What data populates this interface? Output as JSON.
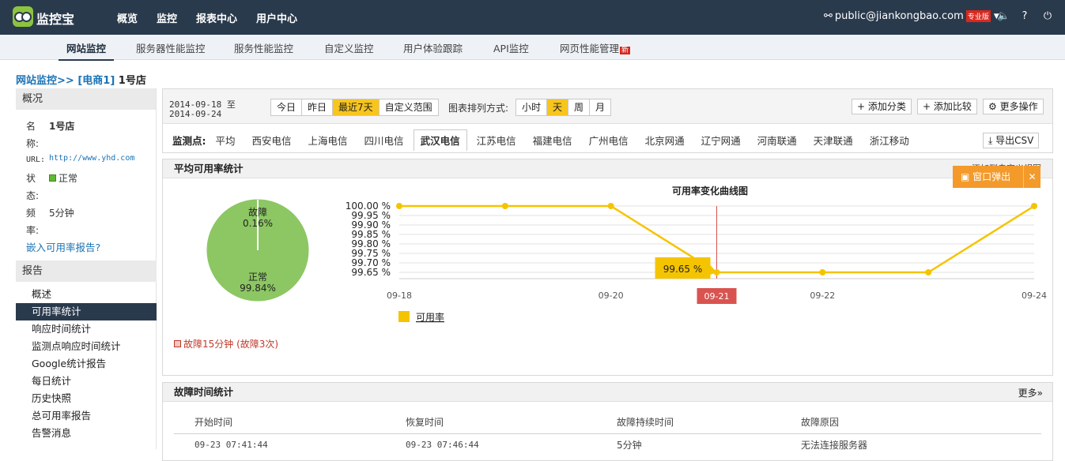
{
  "app": {
    "name": "监控宝"
  },
  "topnav": [
    "概览",
    "监控",
    "报表中心",
    "用户中心"
  ],
  "user": {
    "email": "public@jiankongbao.com",
    "badge": "专业版"
  },
  "subnav": [
    "网站监控",
    "服务器性能监控",
    "服务性能监控",
    "自定义监控",
    "用户体验跟踪",
    "API监控",
    "网页性能管理"
  ],
  "subnav_new": "新",
  "breadcrumb": {
    "part1": "网站监控>>",
    "part2": "[电商1]",
    "part3": "1号店"
  },
  "sidebar": {
    "overview_title": "概况",
    "name_label": "名称:",
    "name_value": "1号店",
    "url_label": "URL:",
    "url_value": "http://www.yhd.com",
    "status_label": "状态:",
    "status_value": "正常",
    "freq_label": "频率:",
    "freq_value": "5分钟",
    "embed_link": "嵌入可用率报告?",
    "report_title": "报告",
    "menu": [
      "概述",
      "可用率统计",
      "响应时间统计",
      "监测点响应时间统计",
      "Google统计报告",
      "每日统计",
      "历史快照",
      "总可用率报告",
      "告警消息"
    ]
  },
  "toolbar": {
    "date_from": "2014-09-18",
    "date_sep": "至",
    "date_to": "2014-09-24",
    "ranges": [
      "今日",
      "昨日",
      "最近7天",
      "自定义范围"
    ],
    "sort_label": "图表排列方式:",
    "units": [
      "小时",
      "天",
      "周",
      "月"
    ],
    "add_category": "添加分类",
    "add_compare": "添加比较",
    "more_ops": "更多操作",
    "probe_label": "监测点:",
    "probes": [
      "平均",
      "西安电信",
      "上海电信",
      "四川电信",
      "武汉电信",
      "江苏电信",
      "福建电信",
      "广州电信",
      "北京网通",
      "辽宁网通",
      "河南联通",
      "天津联通",
      "浙江移动"
    ],
    "export": "导出CSV"
  },
  "availability": {
    "title": "平均可用率统计",
    "add_view": "添加到自定义视图",
    "popout": "窗口弹出",
    "fault_summary": "故障15分钟 (故障3次)"
  },
  "chart_data": [
    {
      "type": "pie",
      "labels": [
        "故障",
        "正常"
      ],
      "values": [
        0.16,
        99.84
      ],
      "value_labels": [
        "0.16%",
        "99.84%"
      ],
      "colors": [
        "#ffffff",
        "#8cc763"
      ]
    },
    {
      "type": "line",
      "title": "可用率变化曲线图",
      "x": [
        "09-18",
        "09-19",
        "09-20",
        "09-21",
        "09-22",
        "09-23",
        "09-24"
      ],
      "x_tick_labels": [
        "09-18",
        "09-20",
        "09-22",
        "09-24"
      ],
      "series": [
        {
          "name": "可用率",
          "values": [
            100.0,
            100.0,
            100.0,
            99.65,
            99.65,
            99.65,
            100.0
          ]
        }
      ],
      "y_ticks": [
        "100.00 %",
        "99.95 %",
        "99.90 %",
        "99.85 %",
        "99.80 %",
        "99.75 %",
        "99.70 %",
        "99.65 %"
      ],
      "ylim": [
        99.65,
        100.0
      ],
      "tooltip": {
        "x": "09-21",
        "value": "99.65 %"
      },
      "line_color": "#f5c400",
      "grid": true,
      "legend": "bottom-left"
    }
  ],
  "faults": {
    "title": "故障时间统计",
    "more": "更多»",
    "columns": [
      "开始时间",
      "恢复时间",
      "故障持续时间",
      "故障原因"
    ],
    "rows": [
      [
        "09-23 07:41:44",
        "09-23 07:46:44",
        "5分钟",
        "无法连接服务器"
      ]
    ]
  }
}
